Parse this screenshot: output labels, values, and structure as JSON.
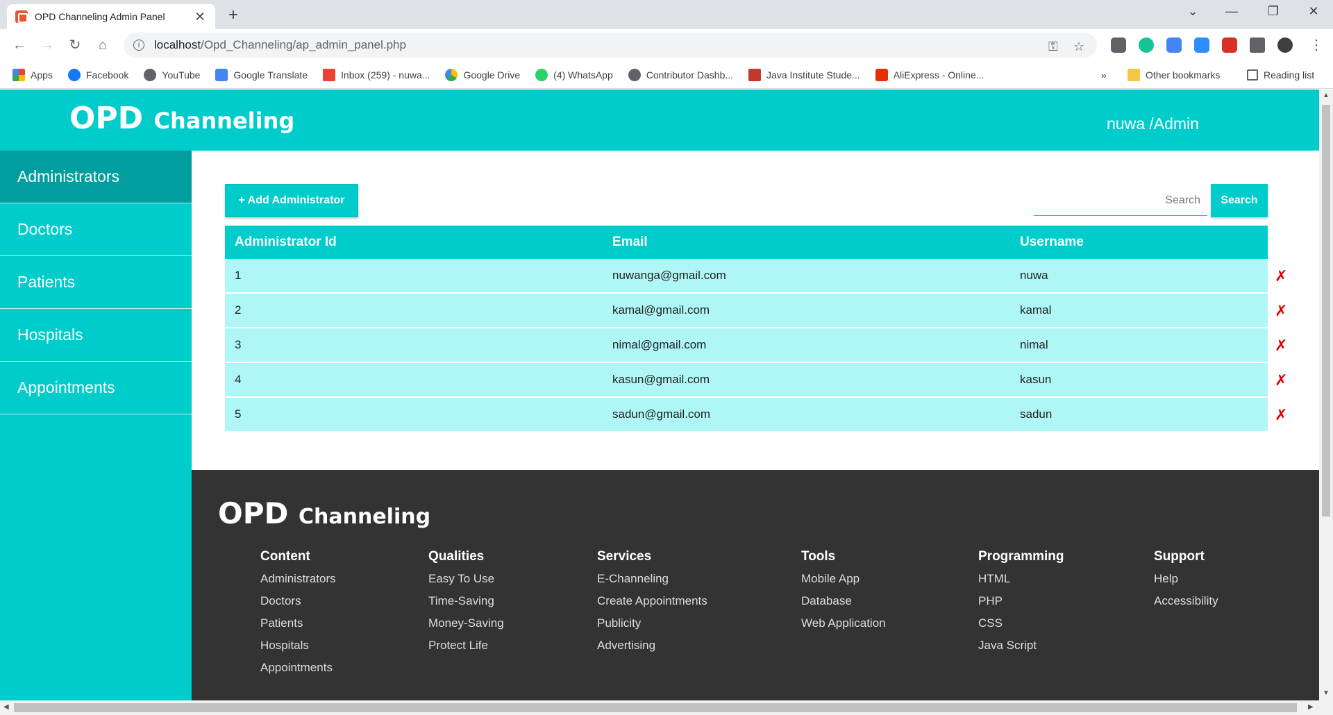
{
  "browser": {
    "tab_title": "OPD Channeling Admin Panel",
    "url_host": "localhost",
    "url_path": "/Opd_Channeling/ap_admin_panel.php",
    "bookmarks": [
      "Apps",
      "Facebook",
      "YouTube",
      "Google Translate",
      "Inbox (259) - nuwa...",
      "Google Drive",
      "(4) WhatsApp",
      "Contributor Dashb...",
      "Java Institute Stude...",
      "AliExpress - Online..."
    ],
    "bookmark_overflow": "»",
    "other_bookmarks": "Other bookmarks",
    "reading_list": "Reading list"
  },
  "header": {
    "brand_main": "OPD",
    "brand_sub": "Channeling",
    "user": "nuwa /Admin"
  },
  "sidebar": {
    "items": [
      "Administrators",
      "Doctors",
      "Patients",
      "Hospitals",
      "Appointments"
    ]
  },
  "main": {
    "add_button": "+ Add Administrator",
    "search_placeholder": "Search",
    "search_button": "Search",
    "table": {
      "headers": [
        "Administrator Id",
        "Email",
        "Username"
      ],
      "rows": [
        {
          "id": "1",
          "email": "nuwanga@gmail.com",
          "username": "nuwa"
        },
        {
          "id": "2",
          "email": "kamal@gmail.com",
          "username": "kamal"
        },
        {
          "id": "3",
          "email": "nimal@gmail.com",
          "username": "nimal"
        },
        {
          "id": "4",
          "email": "kasun@gmail.com",
          "username": "kasun"
        },
        {
          "id": "5",
          "email": "sadun@gmail.com",
          "username": "sadun"
        }
      ],
      "delete_symbol": "✗"
    }
  },
  "footer": {
    "brand_main": "OPD",
    "brand_sub": "Channeling",
    "columns": [
      {
        "title": "Content",
        "links": [
          "Administrators",
          "Doctors",
          "Patients",
          "Hospitals",
          "Appointments"
        ]
      },
      {
        "title": "Qualities",
        "links": [
          "Easy To Use",
          "Time-Saving",
          "Money-Saving",
          "Protect Life"
        ]
      },
      {
        "title": "Services",
        "links": [
          "E-Channeling",
          "Create Appointments",
          "Publicity",
          "Advertising"
        ]
      },
      {
        "title": "Tools",
        "links": [
          "Mobile App",
          "Database",
          "Web Application"
        ]
      },
      {
        "title": "Programming",
        "links": [
          "HTML",
          "PHP",
          "CSS",
          "Java Script"
        ]
      },
      {
        "title": "Support",
        "links": [
          "Help",
          "Accessibility"
        ]
      }
    ]
  },
  "colors": {
    "accent": "#00cccc",
    "accent_dark": "#009e9e",
    "row_bg": "#aff7f7",
    "footer_bg": "#333333",
    "delete": "#e00000"
  }
}
